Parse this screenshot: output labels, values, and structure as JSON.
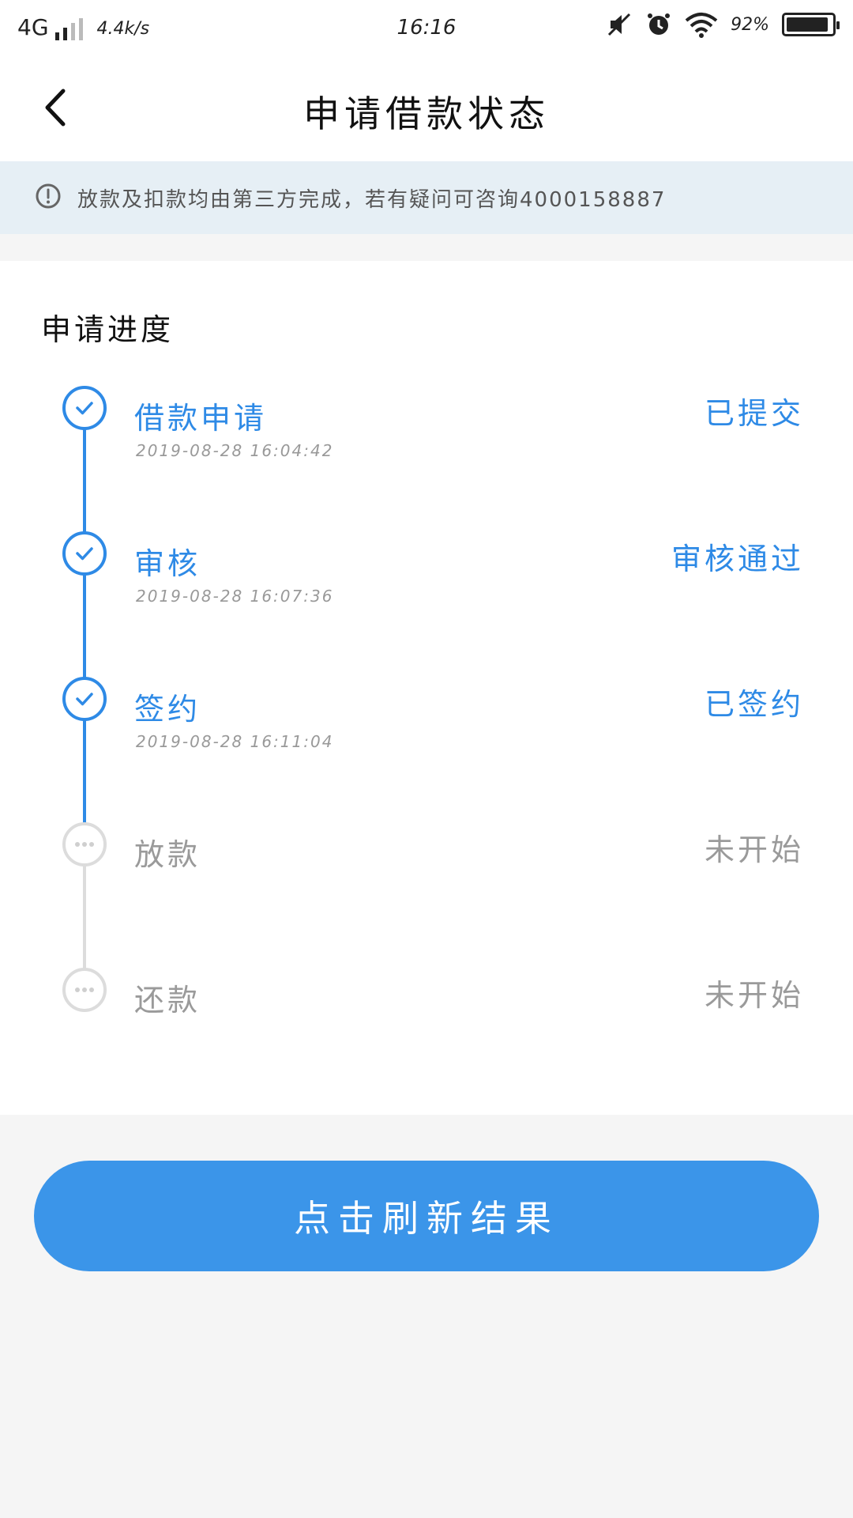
{
  "status_bar": {
    "network": "4G",
    "speed": "4.4k/s",
    "time": "16:16",
    "battery": "92%"
  },
  "nav": {
    "title": "申请借款状态"
  },
  "notice": {
    "text": "放款及扣款均由第三方完成，若有疑问可咨询4000158887"
  },
  "progress": {
    "title": "申请进度",
    "steps": [
      {
        "name": "借款申请",
        "time": "2019-08-28 16:04:42",
        "status": "已提交",
        "state": "done"
      },
      {
        "name": "审核",
        "time": "2019-08-28 16:07:36",
        "status": "审核通过",
        "state": "done"
      },
      {
        "name": "签约",
        "time": "2019-08-28 16:11:04",
        "status": "已签约",
        "state": "done"
      },
      {
        "name": "放款",
        "time": "",
        "status": "未开始",
        "state": "todo"
      },
      {
        "name": "还款",
        "time": "",
        "status": "未开始",
        "state": "todo"
      }
    ]
  },
  "refresh_button": {
    "label": "点击刷新结果"
  },
  "colors": {
    "accent": "#2e8ae6",
    "button": "#3b95e9",
    "inactive": "#dcdcdc",
    "notice_bg": "#e6eff5"
  }
}
